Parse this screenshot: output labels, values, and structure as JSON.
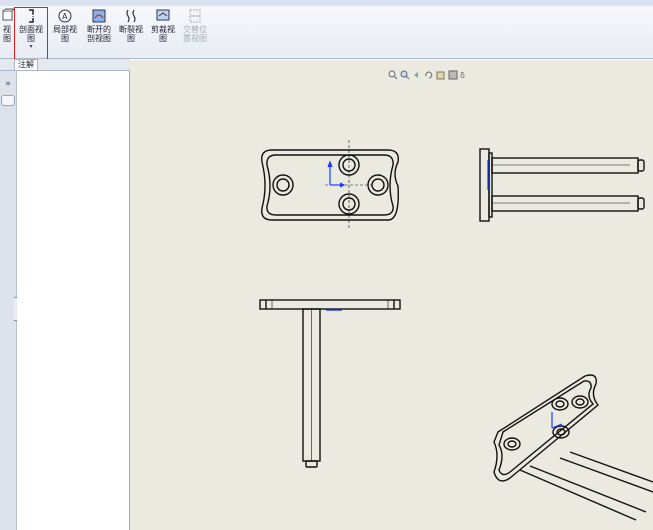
{
  "ribbon": {
    "buttons": [
      {
        "label": "视\n图",
        "icon": "model-view-icon",
        "disabled": false
      },
      {
        "label": "剖面视\n图",
        "icon": "section-view-icon",
        "disabled": false
      },
      {
        "label": "局部视\n图",
        "icon": "detail-view-icon",
        "disabled": false
      },
      {
        "label": "断开的\n剖视图",
        "icon": "broken-out-section-icon",
        "disabled": false
      },
      {
        "label": "断裂视\n图",
        "icon": "break-view-icon",
        "disabled": false
      },
      {
        "label": "剪裁视\n图",
        "icon": "crop-view-icon",
        "disabled": false
      },
      {
        "label": "交替位\n置视图",
        "icon": "alternate-position-view-icon",
        "disabled": true
      }
    ]
  },
  "tabs": {
    "annotation": "注解"
  },
  "panel": {
    "expand_glyph": "»"
  },
  "colors": {
    "sheet": "#ebeae0",
    "highlight": "#e02020",
    "dimension": "#1a3cff"
  }
}
